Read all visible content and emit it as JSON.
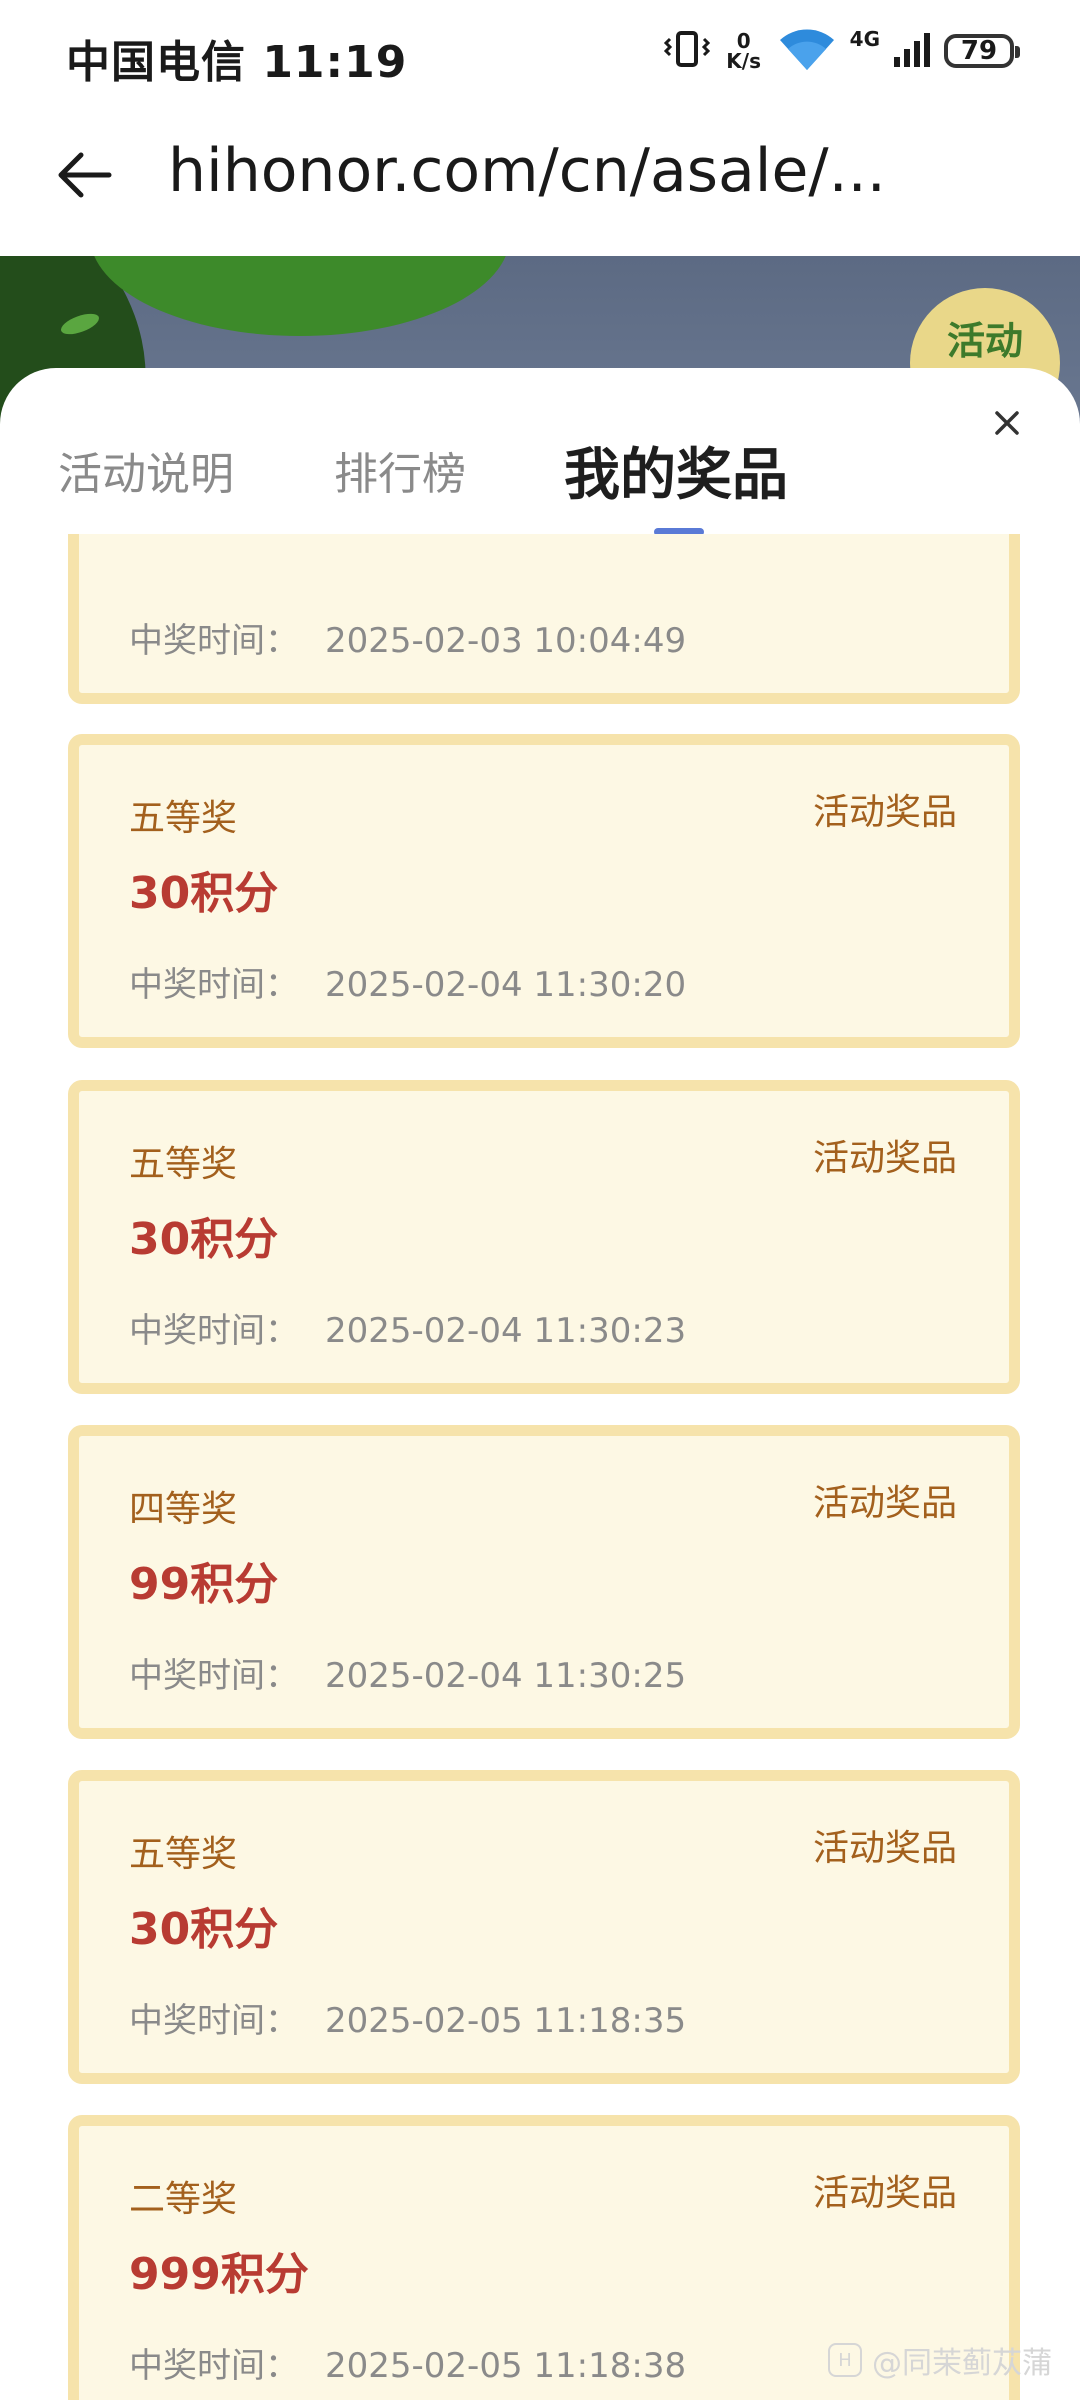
{
  "status_bar": {
    "carrier": "中国电信 11:19",
    "net_speed_value": "0",
    "net_speed_unit": "K/s",
    "network_type": "4G",
    "battery": "79"
  },
  "address_bar": {
    "url": "hihonor.com/cn/asale/..."
  },
  "banner": {
    "badge_text": "活动"
  },
  "sheet": {
    "tabs": [
      "活动说明",
      "排行榜",
      "我的奖品"
    ],
    "active_tab": "我的奖品"
  },
  "prizes": [
    {
      "level": "",
      "points": "",
      "type": "",
      "time_label": "中奖时间：",
      "time": "2025-02-03 10:04:49"
    },
    {
      "level": "五等奖",
      "points": "30积分",
      "type": "活动奖品",
      "time_label": "中奖时间：",
      "time": "2025-02-04 11:30:20"
    },
    {
      "level": "五等奖",
      "points": "30积分",
      "type": "活动奖品",
      "time_label": "中奖时间：",
      "time": "2025-02-04 11:30:23"
    },
    {
      "level": "四等奖",
      "points": "99积分",
      "type": "活动奖品",
      "time_label": "中奖时间：",
      "time": "2025-02-04 11:30:25"
    },
    {
      "level": "五等奖",
      "points": "30积分",
      "type": "活动奖品",
      "time_label": "中奖时间：",
      "time": "2025-02-05 11:18:35"
    },
    {
      "level": "二等奖",
      "points": "999积分",
      "type": "活动奖品",
      "time_label": "中奖时间：",
      "time": "2025-02-05 11:18:38"
    }
  ],
  "watermark": {
    "text": "@同茉蓟苁蒲"
  },
  "colors": {
    "card_bg": "#fdf8e4",
    "card_border": "#f6e3ab",
    "level_text": "#a3601d",
    "points_text": "#b83b32",
    "tab_underline": "#5a7ad6"
  }
}
